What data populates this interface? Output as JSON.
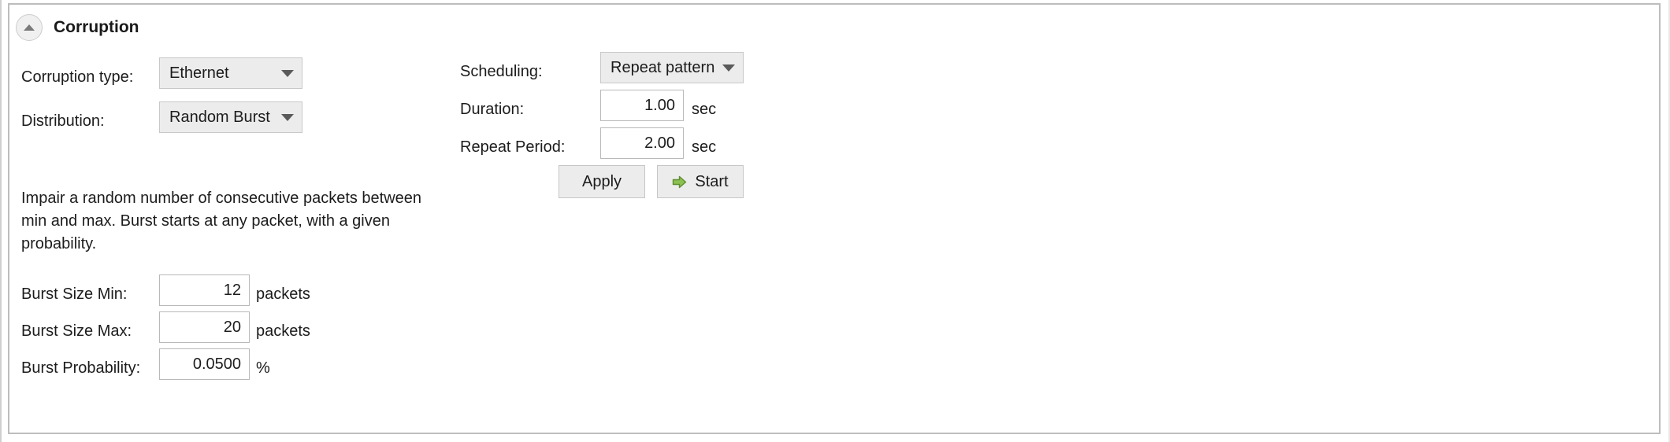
{
  "panel": {
    "title": "Corruption",
    "collapse_icon": "triangle-up-icon",
    "collapsed": false
  },
  "left_column": {
    "corruption_type": {
      "label": "Corruption type:",
      "value": "Ethernet",
      "control": "combobox",
      "dropdown_icon": "chevron-down-icon"
    },
    "distribution": {
      "label": "Distribution:",
      "value": "Random Burst",
      "control": "combobox",
      "dropdown_icon": "chevron-down-icon"
    },
    "description": "Impair a random number of consecutive packets between min and max. Burst starts at any packet, with a given probability.",
    "burst_size_min": {
      "label": "Burst Size Min:",
      "value": "12",
      "unit": "packets"
    },
    "burst_size_max": {
      "label": "Burst Size Max:",
      "value": "20",
      "unit": "packets"
    },
    "burst_probability": {
      "label": "Burst Probability:",
      "value": "0.0500",
      "unit": "%"
    }
  },
  "right_column": {
    "scheduling": {
      "label": "Scheduling:",
      "value": "Repeat pattern",
      "control": "combobox",
      "dropdown_icon": "chevron-down-icon"
    },
    "duration": {
      "label": "Duration:",
      "value": "1.00",
      "unit": "sec"
    },
    "repeat_period": {
      "label": "Repeat Period:",
      "value": "2.00",
      "unit": "sec"
    },
    "actions": {
      "apply_label": "Apply",
      "start_label": "Start",
      "start_icon": "green-arrow-right-icon"
    }
  },
  "colors": {
    "panel_border": "#bdbdbd",
    "combo_fill": "#ececec",
    "combo_border": "#c8c8c8",
    "input_border": "#b9b9b9",
    "button_fill": "#ececec",
    "text": "#1c1c1c",
    "start_arrow_green": "#72a740"
  }
}
